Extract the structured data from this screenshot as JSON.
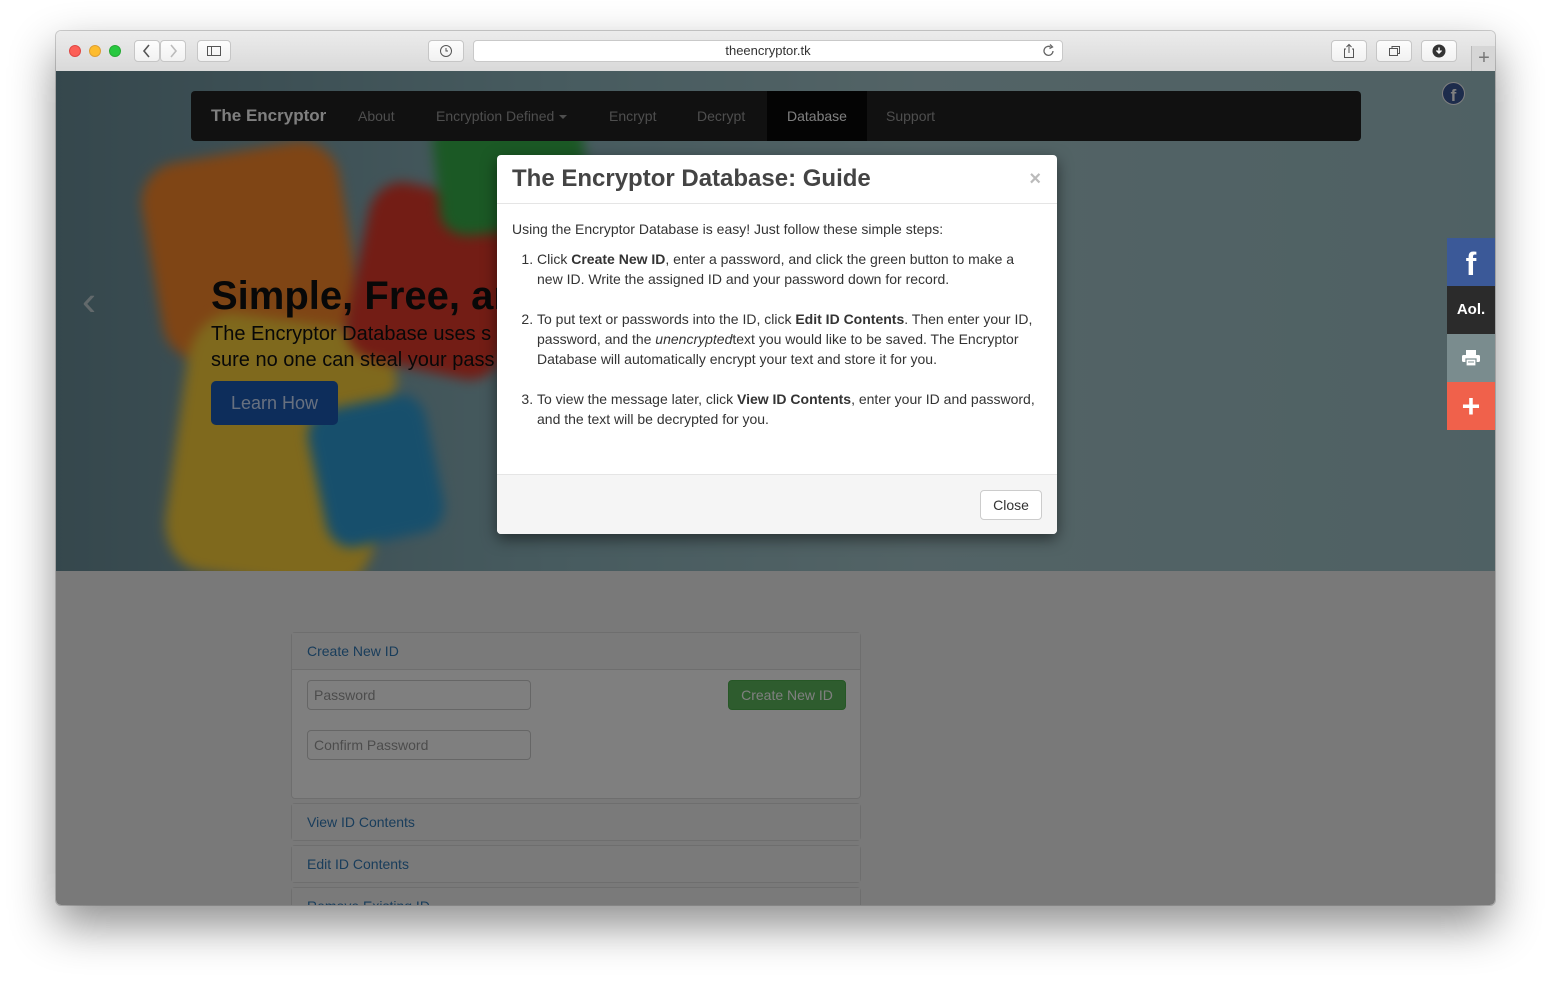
{
  "browser": {
    "url": "theencryptor.tk"
  },
  "navbar": {
    "brand": "The Encryptor",
    "items": [
      "About",
      "Encryption Defined",
      "Encrypt",
      "Decrypt",
      "Database",
      "Support"
    ],
    "active": "Database"
  },
  "hero": {
    "title": "Simple, Free, ar",
    "line1": "The Encryptor Database uses s",
    "line2": "sure no one can steal your pass",
    "button": "Learn How"
  },
  "panels": {
    "create_heading": "Create New ID",
    "password_placeholder": "Password",
    "confirm_placeholder": "Confirm Password",
    "create_button": "Create New ID",
    "view_heading": "View ID Contents",
    "edit_heading": "Edit ID Contents",
    "remove_heading": "Remove Existing ID"
  },
  "share_rail": {
    "facebook": "f",
    "aol": "Aol.",
    "plus": "+"
  },
  "modal": {
    "title": "The Encryptor Database: Guide",
    "close_symbol": "×",
    "intro": "Using the Encryptor Database is easy! Just follow these simple steps:",
    "steps": [
      {
        "pre": "Click ",
        "bold": "Create New ID",
        "post": ", enter a password, and click the green button to make a new ID. Write the assigned ID and your password down for record."
      },
      {
        "pre": "To put text or passwords into the ID, click ",
        "bold": "Edit ID Contents",
        "mid": ". Then enter your ID, password, and the ",
        "italic": "unencrypted",
        "post": "text you would like to be saved. The Encryptor Database will automatically encrypt your text and store it for you."
      },
      {
        "pre": "To view the message later, click ",
        "bold": "View ID Contents",
        "post": ", enter your ID and password, and the text will be decrypted for you."
      }
    ],
    "close_button": "Close"
  },
  "colors": {
    "navbar": "#222222",
    "facebook": "#3b5998",
    "success": "#5cb85c",
    "link": "#337ab7",
    "addthis": "#f0614b"
  }
}
